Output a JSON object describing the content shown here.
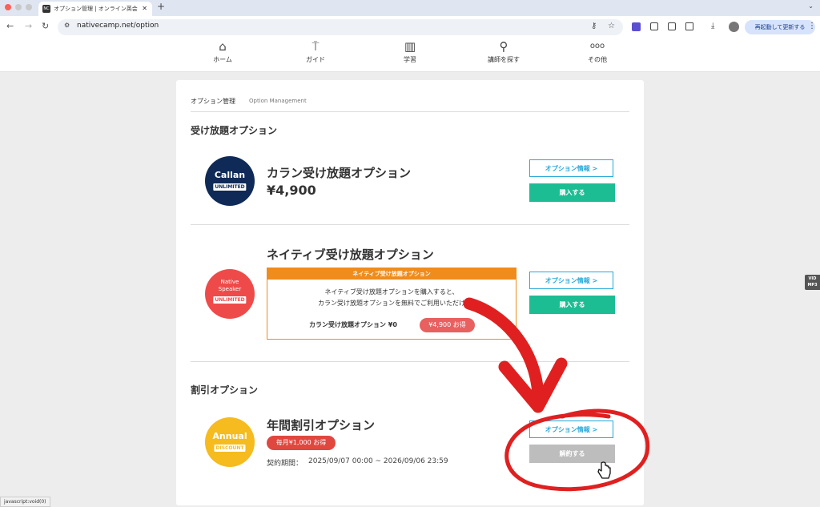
{
  "browser": {
    "tab_title": "オプション管理 | オンライン英会",
    "tab_favicon": "NC",
    "close_glyph": "✕",
    "new_tab_glyph": "+",
    "url": "nativecamp.net/option",
    "update_button": "再起動して更新する",
    "menu_glyph": "⋮"
  },
  "site_nav": {
    "items": [
      {
        "label": "ホーム",
        "icon": "home-icon"
      },
      {
        "label": "ガイド",
        "icon": "signpost-icon"
      },
      {
        "label": "学習",
        "icon": "book-icon"
      },
      {
        "label": "講師を探す",
        "icon": "search-icon"
      },
      {
        "label": "その他",
        "icon": "more-icon"
      }
    ]
  },
  "page": {
    "breadcrumb": "オプション管理",
    "breadcrumb_en": "Option Management",
    "section_unlimited": "受け放題オプション",
    "section_discount": "割引オプション"
  },
  "options": {
    "callan": {
      "logo_main": "Callan",
      "logo_badge": "UNLIMITED",
      "title": "カラン受け放題オプション",
      "price": "¥4,900",
      "info_button": "オプション情報 >",
      "buy_button": "購入する"
    },
    "native": {
      "logo_line1": "Native",
      "logo_line2": "Speaker",
      "logo_badge": "UNLIMITED",
      "title": "ネイティブ受け放題オプション",
      "promo_header": "ネイティブ受け放題オプション",
      "promo_line1": "ネイティブ受け放題オプションを購入すると、",
      "promo_line2": "カラン受け放題オプションを無料でご利用いただけ",
      "promo_price_label": "カラン受け放題オプション ¥0",
      "promo_tag": "¥4,900 お得",
      "info_button": "オプション情報 >",
      "buy_button": "購入する"
    },
    "annual": {
      "logo_main": "Annual",
      "logo_badge": "DISCOUNT",
      "title": "年間割引オプション",
      "tag": "毎月¥1,000 お得",
      "contract_label": "契約期間：",
      "contract_period": "2025/09/07 00:00 ~ 2026/09/06 23:59",
      "info_button": "オプション情報 >",
      "cancel_button": "解約する"
    }
  },
  "status_bar": "javascript:void(0)",
  "side_widget": {
    "line1": "VID",
    "line2": "MP3"
  },
  "colors": {
    "callan_navy": "#0f2a57",
    "native_red": "#ef4a4a",
    "annual_yellow": "#f5bb1f",
    "info_blue": "#27a9d9",
    "buy_green": "#1dbd94",
    "promo_orange": "#ef8c1c",
    "annotation_red": "#e02020"
  }
}
